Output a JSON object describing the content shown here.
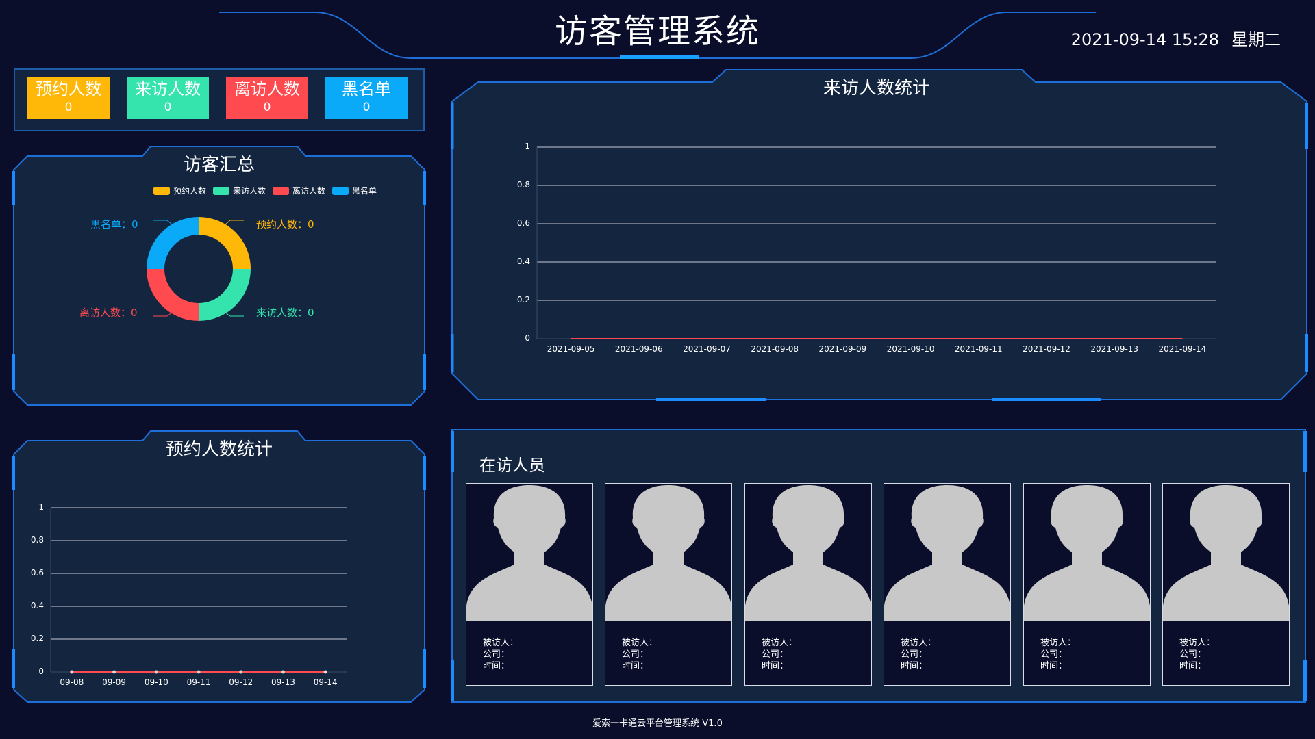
{
  "header": {
    "title": "访客管理系统",
    "date": "2021-09-14 15:28",
    "weekday": "星期二"
  },
  "stats": [
    {
      "label": "预约人数",
      "value": "0",
      "color": "#ffb708"
    },
    {
      "label": "来访人数",
      "value": "0",
      "color": "#35e3ac"
    },
    {
      "label": "离访人数",
      "value": "0",
      "color": "#ff4a4f"
    },
    {
      "label": "黑名单",
      "value": "0",
      "color": "#0aaaf9"
    }
  ],
  "summary": {
    "title": "访客汇总",
    "legend": [
      "预约人数",
      "来访人数",
      "离访人数",
      "黑名单"
    ],
    "labels": {
      "booked": "预约人数：0",
      "visited": "来访人数：0",
      "left": "离访人数：0",
      "blacklist": "黑名单：0"
    }
  },
  "visit_chart": {
    "title": "来访人数统计"
  },
  "booking_chart": {
    "title": "预约人数统计"
  },
  "visitors": {
    "title": "在访人员",
    "field_host": "被访人：",
    "field_company": "公司：",
    "field_time": "时间：",
    "count": 6
  },
  "footer": "爱索一卡通云平台管理系统 V1.0",
  "chart_data": [
    {
      "type": "pie",
      "categories": [
        "预约人数",
        "来访人数",
        "离访人数",
        "黑名单"
      ],
      "values": [
        0,
        0,
        0,
        0
      ],
      "colors": [
        "#ffb708",
        "#35e3ac",
        "#ff4a4f",
        "#0aaaf9"
      ],
      "title": "访客汇总",
      "legend": "top"
    },
    {
      "type": "line",
      "title": "来访人数统计",
      "x": [
        "2021-09-05",
        "2021-09-06",
        "2021-09-07",
        "2021-09-08",
        "2021-09-09",
        "2021-09-10",
        "2021-09-11",
        "2021-09-12",
        "2021-09-13",
        "2021-09-14"
      ],
      "series": [
        {
          "values": [
            0,
            0,
            0,
            0,
            0,
            0,
            0,
            0,
            0,
            0
          ]
        }
      ],
      "ylim": [
        0,
        1
      ],
      "yticks": [
        "0",
        "0.2",
        "0.4",
        "0.6",
        "0.8",
        "1"
      ],
      "grid": true
    },
    {
      "type": "line",
      "title": "预约人数统计",
      "x": [
        "09-08",
        "09-09",
        "09-10",
        "09-11",
        "09-12",
        "09-13",
        "09-14"
      ],
      "series": [
        {
          "values": [
            0,
            0,
            0,
            0,
            0,
            0,
            0
          ],
          "color": "#ff4a4f"
        }
      ],
      "ylim": [
        0,
        1
      ],
      "yticks": [
        "0",
        "0.2",
        "0.4",
        "0.6",
        "0.8",
        "1"
      ],
      "grid": true
    }
  ]
}
